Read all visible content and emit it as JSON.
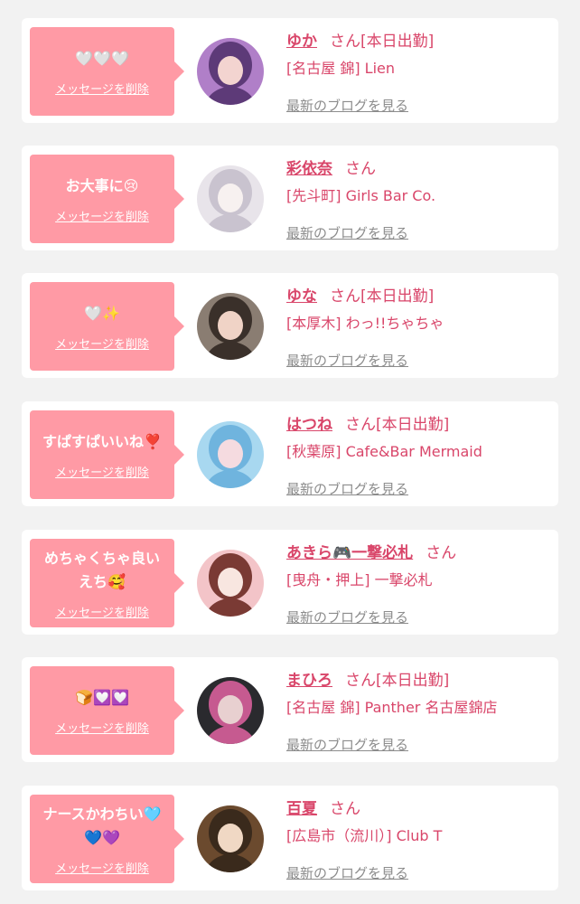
{
  "colors": {
    "background": "#f2f2f2",
    "card": "#ffffff",
    "bubble": "#ff9aa5",
    "name_text": "#d9466a",
    "blog_link": "#8c8c8c"
  },
  "delete_label": "メッセージを削除",
  "blog_label": "最新のブログを見る",
  "san_label": "さん",
  "cards": [
    {
      "message": "🤍🤍🤍",
      "name": "ゆか",
      "status": "[本日出勤]",
      "shop": "[名古屋 錦] Lien",
      "avatar_colors": [
        "#b07fc8",
        "#5d3a78",
        "#f3d4d0"
      ]
    },
    {
      "message": "お大事に😢",
      "name": "彩依奈",
      "status": "",
      "shop": "[先斗町] Girls Bar Co.",
      "avatar_colors": [
        "#e8e4ea",
        "#c9c3cf",
        "#f7f1f0"
      ]
    },
    {
      "message": "🤍✨",
      "name": "ゆな",
      "status": "[本日出勤]",
      "shop": "[本厚木] わっ!!ちゃちゃ",
      "avatar_colors": [
        "#8a7d72",
        "#3a302a",
        "#f0d3c6"
      ]
    },
    {
      "message": "すぱすぱいいね❣️",
      "name": "はつね",
      "status": "[本日出勤]",
      "shop": "[秋葉原] Cafe&Bar Mermaid",
      "avatar_colors": [
        "#a8d8f0",
        "#6fb4de",
        "#f5dbe0"
      ]
    },
    {
      "message": "めちゃくちゃ良い\nえち🥰",
      "name": "あきら🎮一撃必札",
      "status": "",
      "shop": "[曳舟・押上] 一撃必札",
      "avatar_colors": [
        "#f3c4c8",
        "#7a3a34",
        "#f8e6e0"
      ]
    },
    {
      "message": "🍞💟💟",
      "name": "まひろ",
      "status": "[本日出勤]",
      "shop": "[名古屋 錦] Panther 名古屋錦店",
      "avatar_colors": [
        "#2a2a2e",
        "#c65a90",
        "#e8d0d0"
      ]
    },
    {
      "message": "ナースかわちい🩵\n💙💜",
      "name": "百夏",
      "status": "",
      "shop": "[広島市（流川）] Club T",
      "avatar_colors": [
        "#6b4a2e",
        "#3a2a1c",
        "#f0d8c4"
      ]
    }
  ]
}
